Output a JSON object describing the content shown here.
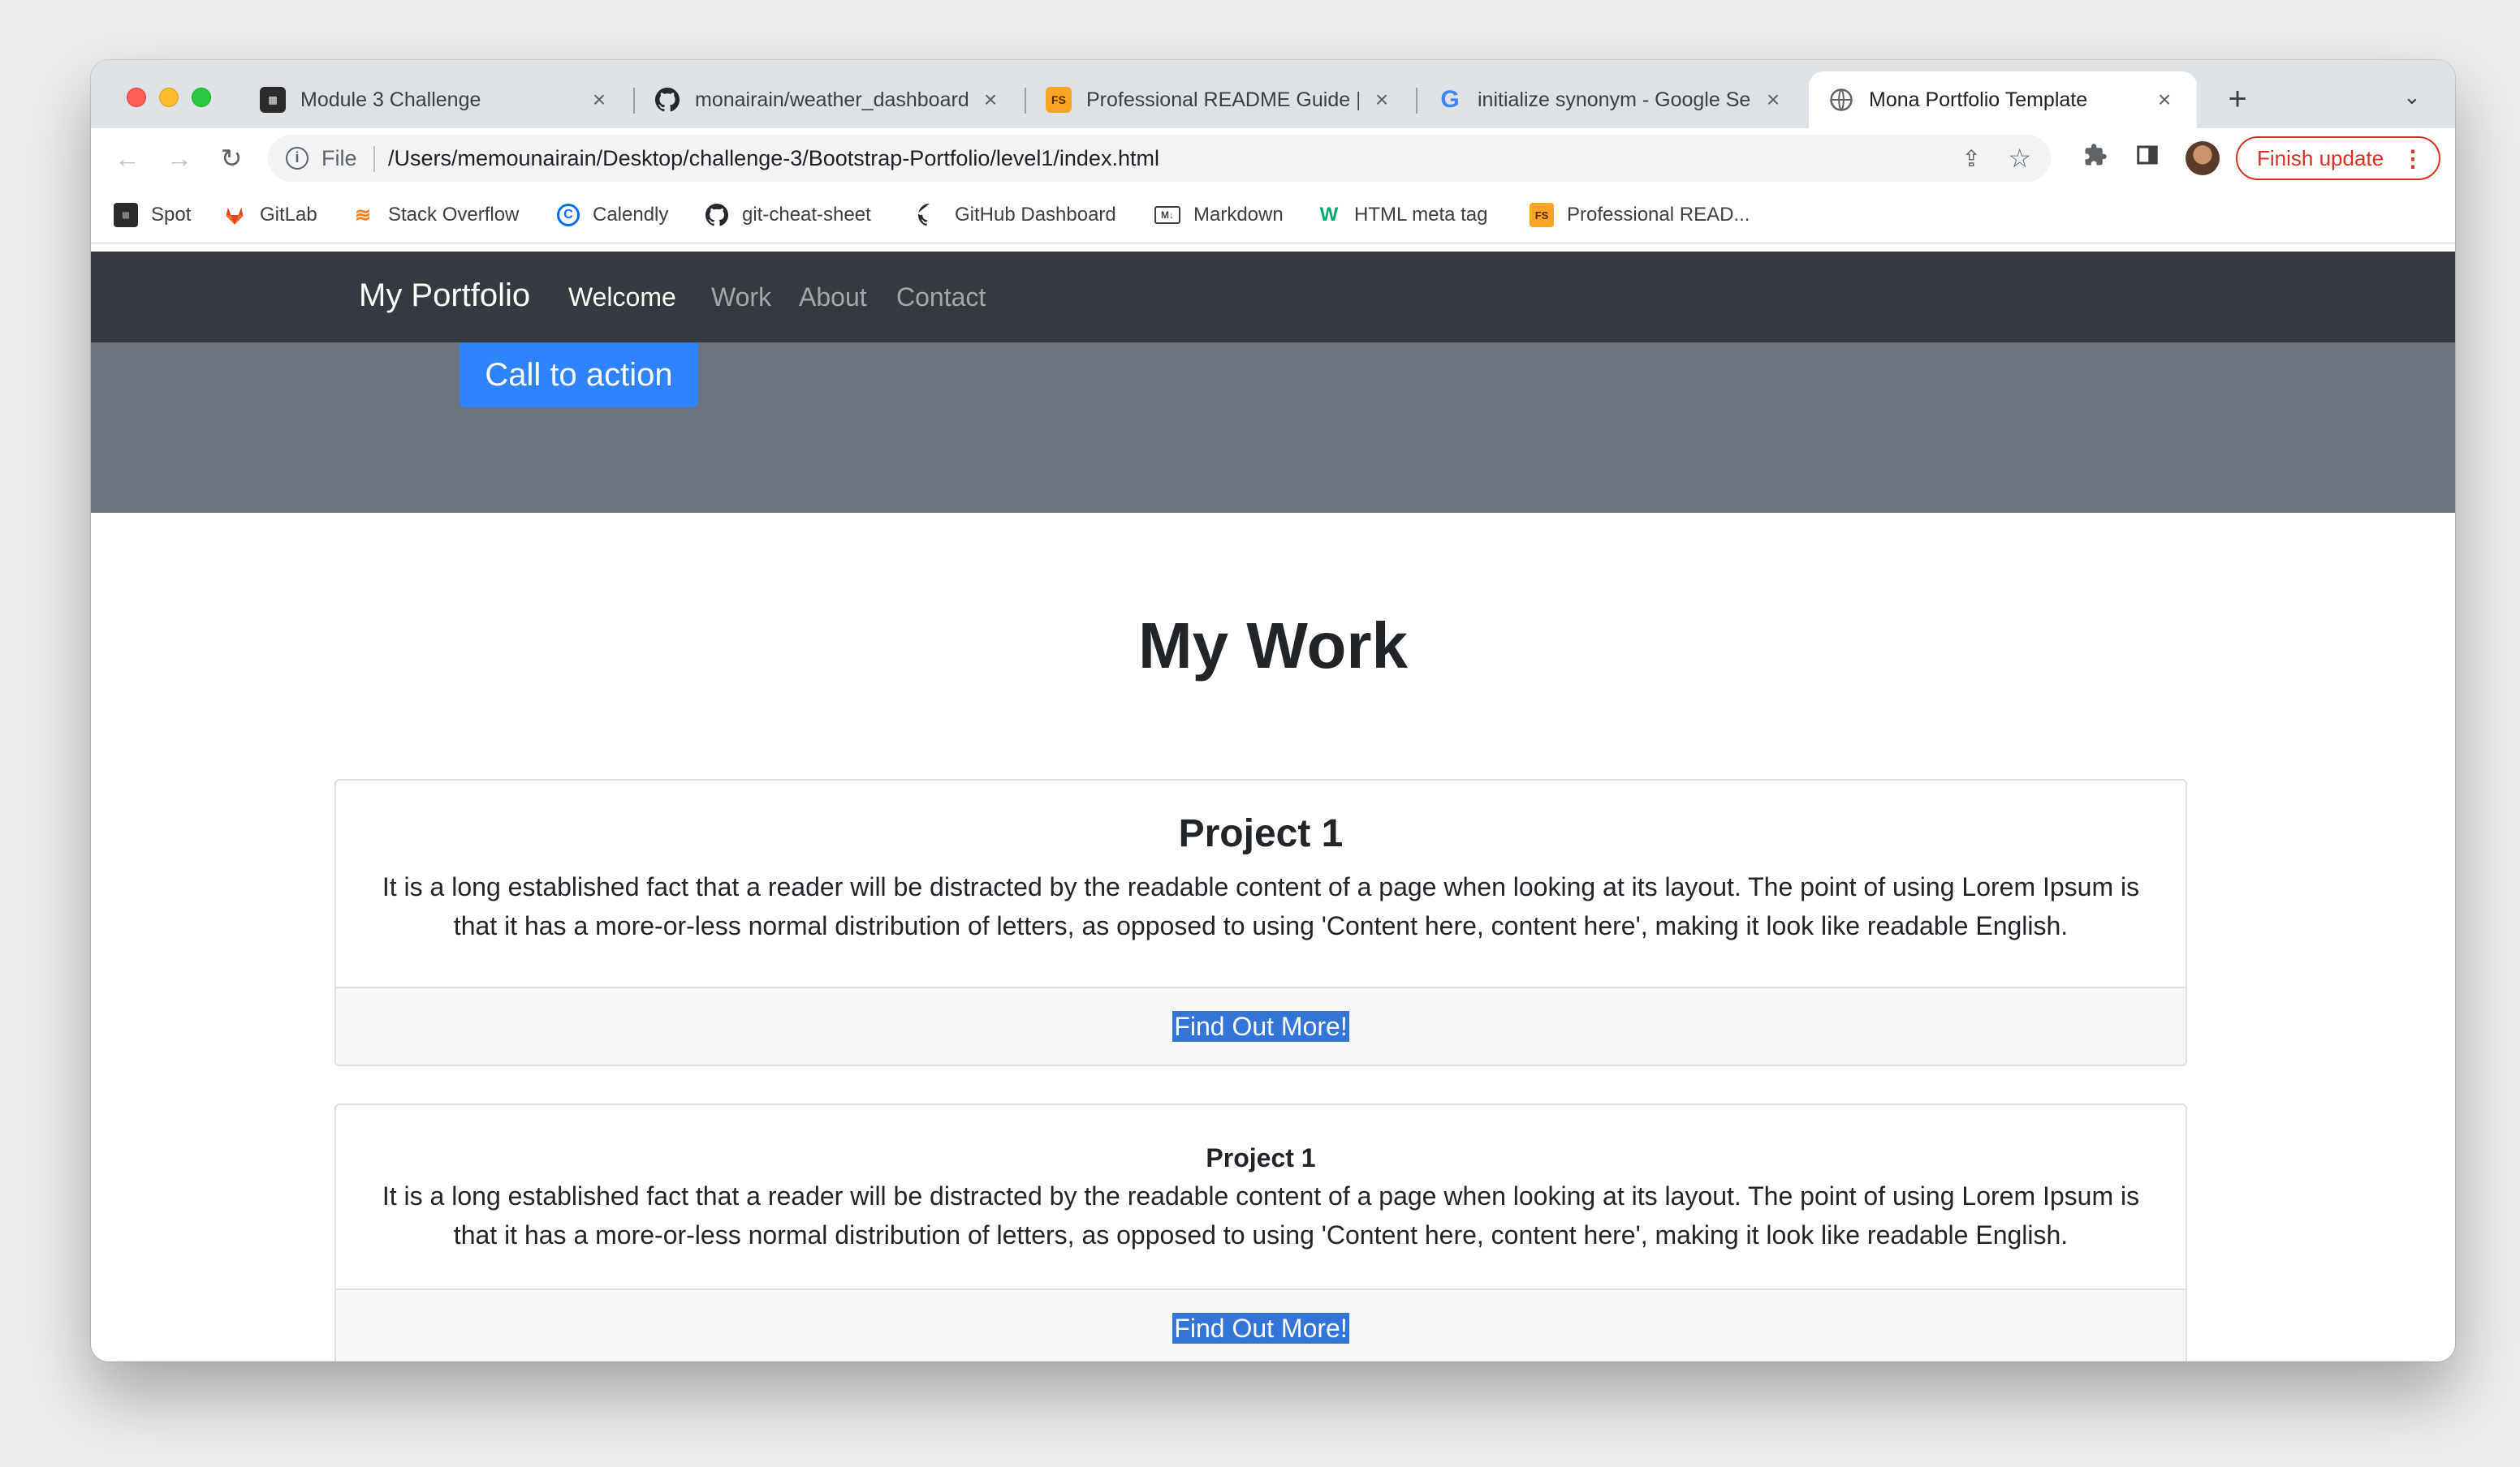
{
  "browser": {
    "tabs": [
      {
        "title": "Module 3 Challenge",
        "icon": "module-icon"
      },
      {
        "title": "monairain/weather_dashboard",
        "icon": "github-icon"
      },
      {
        "title": "Professional README Guide | ",
        "icon": "fs-icon"
      },
      {
        "title": "initialize synonym - Google Se",
        "icon": "google-icon"
      },
      {
        "title": "Mona Portfolio Template",
        "icon": "globe-icon"
      }
    ],
    "address": {
      "scheme": "File",
      "url": "/Users/memounairain/Desktop/challenge-3/Bootstrap-Portfolio/level1/index.html"
    },
    "update_button": "Finish update",
    "bookmarks": [
      {
        "label": "Spot",
        "icon": "spot-icon"
      },
      {
        "label": "GitLab",
        "icon": "gitlab-icon"
      },
      {
        "label": "Stack Overflow",
        "icon": "stackoverflow-icon"
      },
      {
        "label": "Calendly",
        "icon": "calendly-icon"
      },
      {
        "label": "git-cheat-sheet",
        "icon": "github-icon"
      },
      {
        "label": "GitHub Dashboard",
        "icon": "github-icon"
      },
      {
        "label": "Markdown",
        "icon": "markdown-icon"
      },
      {
        "label": "HTML meta tag",
        "icon": "w3-icon"
      },
      {
        "label": "Professional READ...",
        "icon": "fs-icon"
      }
    ]
  },
  "site": {
    "brand": "My Portfolio",
    "nav": [
      "Welcome",
      "Work",
      "About",
      "Contact"
    ],
    "active_nav": "Welcome",
    "cta": "Call to action",
    "section_title": "My Work",
    "cards": [
      {
        "title": "Project 1",
        "text": "It is a long established fact that a reader will be distracted by the readable content of a page when looking at its layout. The point of using Lorem Ipsum is that it has a more-or-less normal distribution of letters, as opposed to using 'Content here, content here', making it look like readable English.",
        "link": "Find Out More!"
      },
      {
        "title": "Project 1",
        "text": "It is a long established fact that a reader will be distracted by the readable content of a page when looking at its layout. The point of using Lorem Ipsum is that it has a more-or-less normal distribution of letters, as opposed to using 'Content here, content here', making it look like readable English.",
        "link": "Find Out More!"
      }
    ]
  },
  "colors": {
    "navbar": "#343a40",
    "hero": "#6c757d",
    "cta": "#3083ff",
    "link_highlight": "#3375d6",
    "update_red": "#d93025"
  }
}
